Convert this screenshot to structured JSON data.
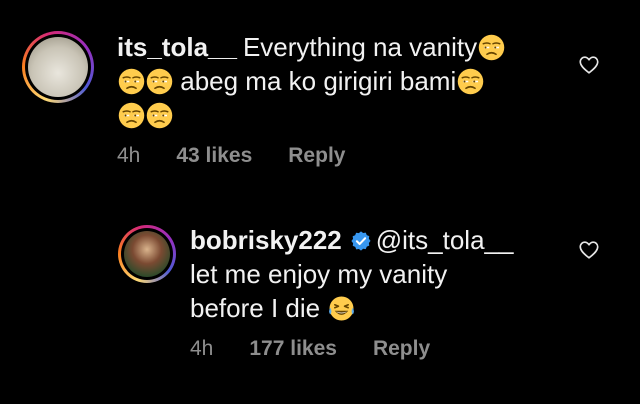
{
  "comments": [
    {
      "username": "its_tola__",
      "line1": "Everything na vanity",
      "line2": "abeg ma ko girigiri bami",
      "time": "4h",
      "likes": "43 likes",
      "reply": "Reply"
    },
    {
      "username": "bobrisky222",
      "mention": "@its_tola__",
      "line1": "let me enjoy my vanity",
      "line2": "before I die",
      "time": "4h",
      "likes": "177 likes",
      "reply": "Reply"
    }
  ],
  "icons": {
    "like": "heart-icon",
    "verified": "verified-badge-icon",
    "unamused": "unamused-face-emoji",
    "laughing": "tears-of-joy-emoji"
  },
  "colors": {
    "background": "#000000",
    "text": "#f2f2f2",
    "meta": "#8e8e8e",
    "verified": "#3897f0"
  }
}
